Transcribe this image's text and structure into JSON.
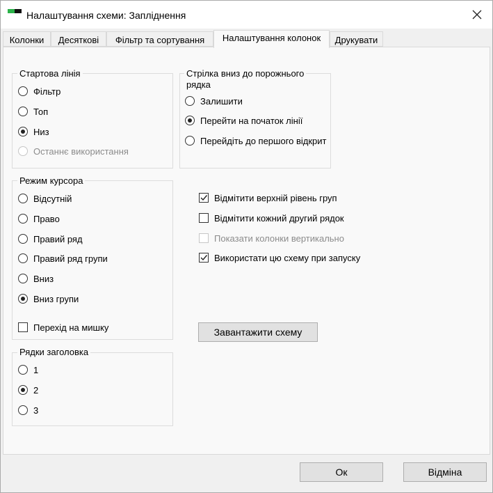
{
  "window": {
    "title": "Налаштування схеми: Запліднення"
  },
  "icons": {
    "app": "app-icon",
    "close": "close-icon"
  },
  "tabs": [
    {
      "label": "Колонки"
    },
    {
      "label": "Десяткові"
    },
    {
      "label": "Фільтр та сортування"
    },
    {
      "label": "Налаштування колонок"
    },
    {
      "label": "Друкувати"
    }
  ],
  "start_line": {
    "title": "Стартова лінія",
    "options": [
      "Фільтр",
      "Топ",
      "Низ",
      "Останнє використання"
    ],
    "selected": "Низ",
    "disabled": [
      "Останнє використання"
    ]
  },
  "arrow_down": {
    "title_line1": "Стрілка вниз до порожнього",
    "title_line2": "рядка",
    "options": [
      "Залишити",
      "Перейти на початок лінії",
      "Перейдіть до першого відкрит"
    ],
    "selected": "Перейти на початок лінії"
  },
  "cursor_mode": {
    "title": "Режим курсора",
    "options": [
      "Відсутній",
      "Право",
      "Правий ряд",
      "Правий ряд групи",
      "Вниз",
      "Вниз групи"
    ],
    "selected": "Вниз групи",
    "mouse_jump": {
      "label": "Перехід на мишку",
      "checked": false
    }
  },
  "header_rows": {
    "title": "Рядки заголовка",
    "options": [
      "1",
      "2",
      "3"
    ],
    "selected": "2"
  },
  "checkboxes": [
    {
      "label": "Відмітити верхній рівень груп",
      "checked": true,
      "disabled": false
    },
    {
      "label": "Відмітити кожний другий рядок",
      "checked": false,
      "disabled": false
    },
    {
      "label": "Показати колонки вертикально",
      "checked": false,
      "disabled": true
    },
    {
      "label": "Використати цю схему при запуску",
      "checked": true,
      "disabled": false
    }
  ],
  "load_scheme_label": "Завантажити схему",
  "ok_label": "Ок",
  "cancel_label": "Відміна"
}
